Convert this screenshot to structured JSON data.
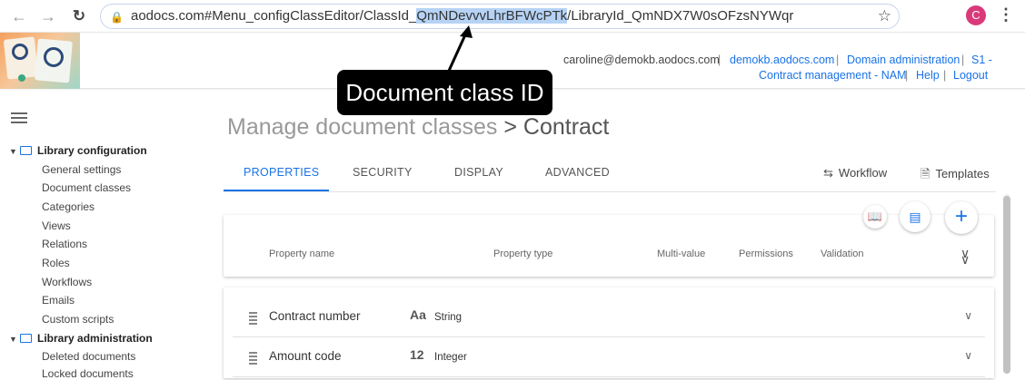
{
  "browser": {
    "url_prefix": "aodocs.com#Menu_configClassEditor/ClassId_",
    "url_highlight": "QmNDevvvLhrBFWcPTk",
    "url_suffix": "/LibraryId_QmNDX7W0sOFzsNYWqr",
    "profile_initial": "C",
    "icons": [
      "back-arrow-icon",
      "forward-arrow-icon",
      "reload-icon",
      "lock-icon",
      "star-icon",
      "kebab-menu-icon"
    ]
  },
  "header": {
    "user_email": "caroline@demokb.aodocs.com",
    "domain_link": "demokb.aodocs.com",
    "admin_link": "Domain administration",
    "library_link_line1": "S1 -",
    "library_link_line2": "Contract management - NAM",
    "help_link": "Help",
    "logout_link": "Logout",
    "separator": "|"
  },
  "callout": {
    "text": "Document class ID"
  },
  "sidebar": {
    "groups": [
      {
        "label": "Library configuration",
        "items": [
          "General settings",
          "Document classes",
          "Categories",
          "Views",
          "Relations",
          "Roles",
          "Workflows",
          "Emails",
          "Custom scripts"
        ]
      },
      {
        "label": "Library administration",
        "items": [
          "Deleted documents",
          "Locked documents"
        ]
      }
    ]
  },
  "main": {
    "title": "Manage document classes",
    "subtitle": "> Contract",
    "tabs": [
      {
        "label": "PROPERTIES",
        "active": true
      },
      {
        "label": "SECURITY",
        "active": false
      },
      {
        "label": "DISPLAY",
        "active": false
      },
      {
        "label": "ADVANCED",
        "active": false
      }
    ],
    "workflow_label": "Workflow",
    "templates_label": "Templates",
    "columns": [
      "Property name",
      "Property type",
      "Multi-value",
      "Permissions",
      "Validation"
    ],
    "rows": [
      {
        "name": "Contract number",
        "type_icon": "Aa",
        "type": "String"
      },
      {
        "name": "Amount code",
        "type_icon": "12",
        "type": "Integer"
      }
    ]
  },
  "colors": {
    "accent": "#1a73e8",
    "callout_bg": "#000000",
    "url_highlight": "#b6d3f5"
  }
}
